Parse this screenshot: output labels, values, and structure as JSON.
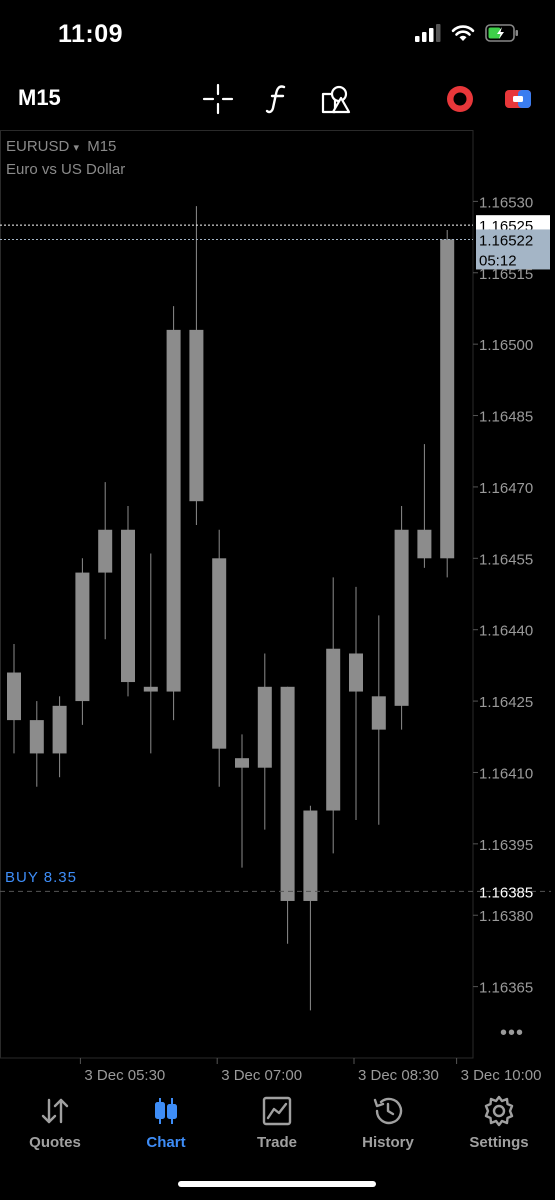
{
  "status": {
    "time": "11:09"
  },
  "toolbar": {
    "timeframe": "M15",
    "icons": [
      "crosshair-icon",
      "function-icon",
      "objects-icon",
      "one-click-trading-icon",
      "trade-switch-icon"
    ]
  },
  "chart": {
    "symbol": "EURUSD",
    "dropdown_glyph": "▾",
    "timeframe": "M15",
    "description": "Euro vs US Dollar",
    "buy_label": "BUY 8.35",
    "current_price": "1.16522",
    "bar_timer": "05:12",
    "bid_price": "1.16525",
    "buy_price_tag": "1.16385",
    "more_glyph": "•••",
    "colors": {
      "candle": "#8c8c8c",
      "grid": "#2a2a2a",
      "buy": "#3e8df7",
      "ask_tag": "#a4b5c6",
      "bid_tag": "#ffffff"
    }
  },
  "chart_data": {
    "type": "candlestick",
    "ylim": [
      1.1635,
      1.16545
    ],
    "y_ticks": [
      "1.16530",
      "1.16515",
      "1.16500",
      "1.16485",
      "1.16470",
      "1.16455",
      "1.16440",
      "1.16425",
      "1.16410",
      "1.16395",
      "1.16380",
      "1.16365"
    ],
    "x_ticks": [
      "3 Dec 05:30",
      "3 Dec 07:00",
      "3 Dec 08:30",
      "3 Dec 10:00"
    ],
    "candles": [
      {
        "o": 1.16431,
        "h": 1.16437,
        "l": 1.16414,
        "c": 1.16421
      },
      {
        "o": 1.16421,
        "h": 1.16425,
        "l": 1.16407,
        "c": 1.16414
      },
      {
        "o": 1.16414,
        "h": 1.16426,
        "l": 1.16409,
        "c": 1.16424
      },
      {
        "o": 1.16425,
        "h": 1.16455,
        "l": 1.1642,
        "c": 1.16452
      },
      {
        "o": 1.16452,
        "h": 1.16471,
        "l": 1.16438,
        "c": 1.16461
      },
      {
        "o": 1.16461,
        "h": 1.16466,
        "l": 1.16426,
        "c": 1.16429
      },
      {
        "o": 1.16427,
        "h": 1.16456,
        "l": 1.16414,
        "c": 1.16428
      },
      {
        "o": 1.16427,
        "h": 1.16508,
        "l": 1.16421,
        "c": 1.16503
      },
      {
        "o": 1.16503,
        "h": 1.16529,
        "l": 1.16462,
        "c": 1.16467
      },
      {
        "o": 1.16455,
        "h": 1.16461,
        "l": 1.16407,
        "c": 1.16415
      },
      {
        "o": 1.16413,
        "h": 1.16418,
        "l": 1.1639,
        "c": 1.16411
      },
      {
        "o": 1.16411,
        "h": 1.16435,
        "l": 1.16398,
        "c": 1.16428
      },
      {
        "o": 1.16428,
        "h": 1.16426,
        "l": 1.16374,
        "c": 1.16383
      },
      {
        "o": 1.16383,
        "h": 1.16403,
        "l": 1.1636,
        "c": 1.16402
      },
      {
        "o": 1.16402,
        "h": 1.16451,
        "l": 1.16393,
        "c": 1.16436
      },
      {
        "o": 1.16435,
        "h": 1.16449,
        "l": 1.164,
        "c": 1.16427
      },
      {
        "o": 1.16419,
        "h": 1.16443,
        "l": 1.16399,
        "c": 1.16426
      },
      {
        "o": 1.16424,
        "h": 1.16466,
        "l": 1.16419,
        "c": 1.16461
      },
      {
        "o": 1.16461,
        "h": 1.16479,
        "l": 1.16453,
        "c": 1.16455
      },
      {
        "o": 1.16455,
        "h": 1.16524,
        "l": 1.16451,
        "c": 1.16522
      }
    ]
  },
  "nav": {
    "items": [
      {
        "label": "Quotes",
        "icon": "quotes-icon"
      },
      {
        "label": "Chart",
        "icon": "chart-icon"
      },
      {
        "label": "Trade",
        "icon": "trade-icon"
      },
      {
        "label": "History",
        "icon": "history-icon"
      },
      {
        "label": "Settings",
        "icon": "settings-icon"
      }
    ],
    "active": "Chart"
  }
}
